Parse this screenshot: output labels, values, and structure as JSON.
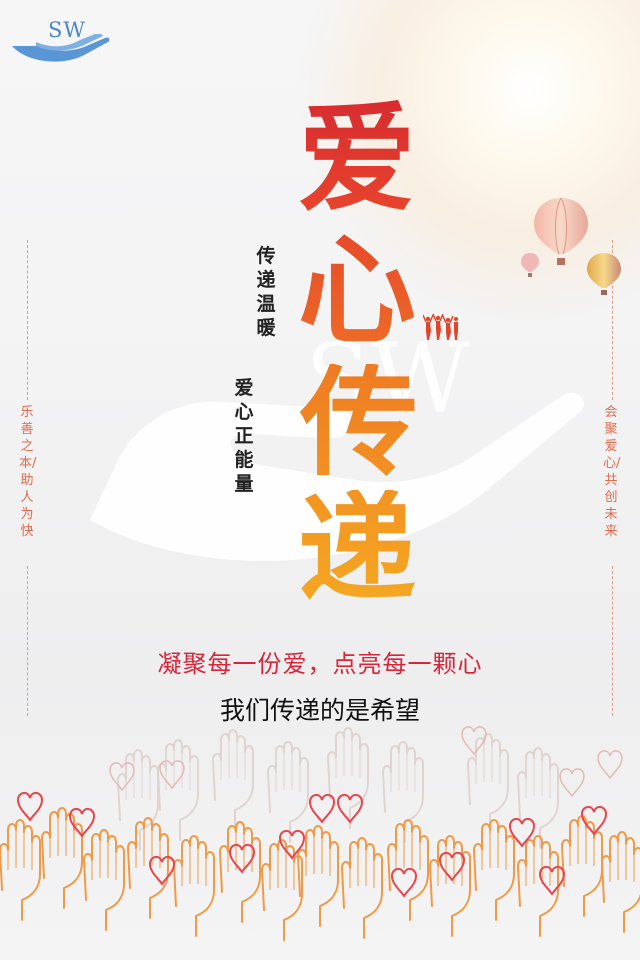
{
  "logo": {
    "text": "SW",
    "color": "#4a86c8"
  },
  "headline": {
    "chars": [
      "爱",
      "心",
      "传",
      "递"
    ]
  },
  "vertical_caption": {
    "col1": "传递温暖",
    "col2": "爱心正能量"
  },
  "side_left": {
    "text": "乐善之本/助人为快"
  },
  "side_right": {
    "text": "会聚爱心/共创未来"
  },
  "tagline": {
    "primary": "凝聚每一份爱，点亮每一颗心",
    "secondary": "我们传递的是希望"
  },
  "watermark": {
    "text": "SW"
  },
  "colors": {
    "accent_red": "#d8253a",
    "accent_orange": "#f08a24",
    "heart_red": "#e8454d",
    "hand_orange": "#ef9a47",
    "logo_blue": "#4a86c8"
  },
  "icons": [
    "hand-heart-logo-icon",
    "hot-air-balloon-icon",
    "people-cheering-icon",
    "hands-with-hearts-illustration"
  ]
}
